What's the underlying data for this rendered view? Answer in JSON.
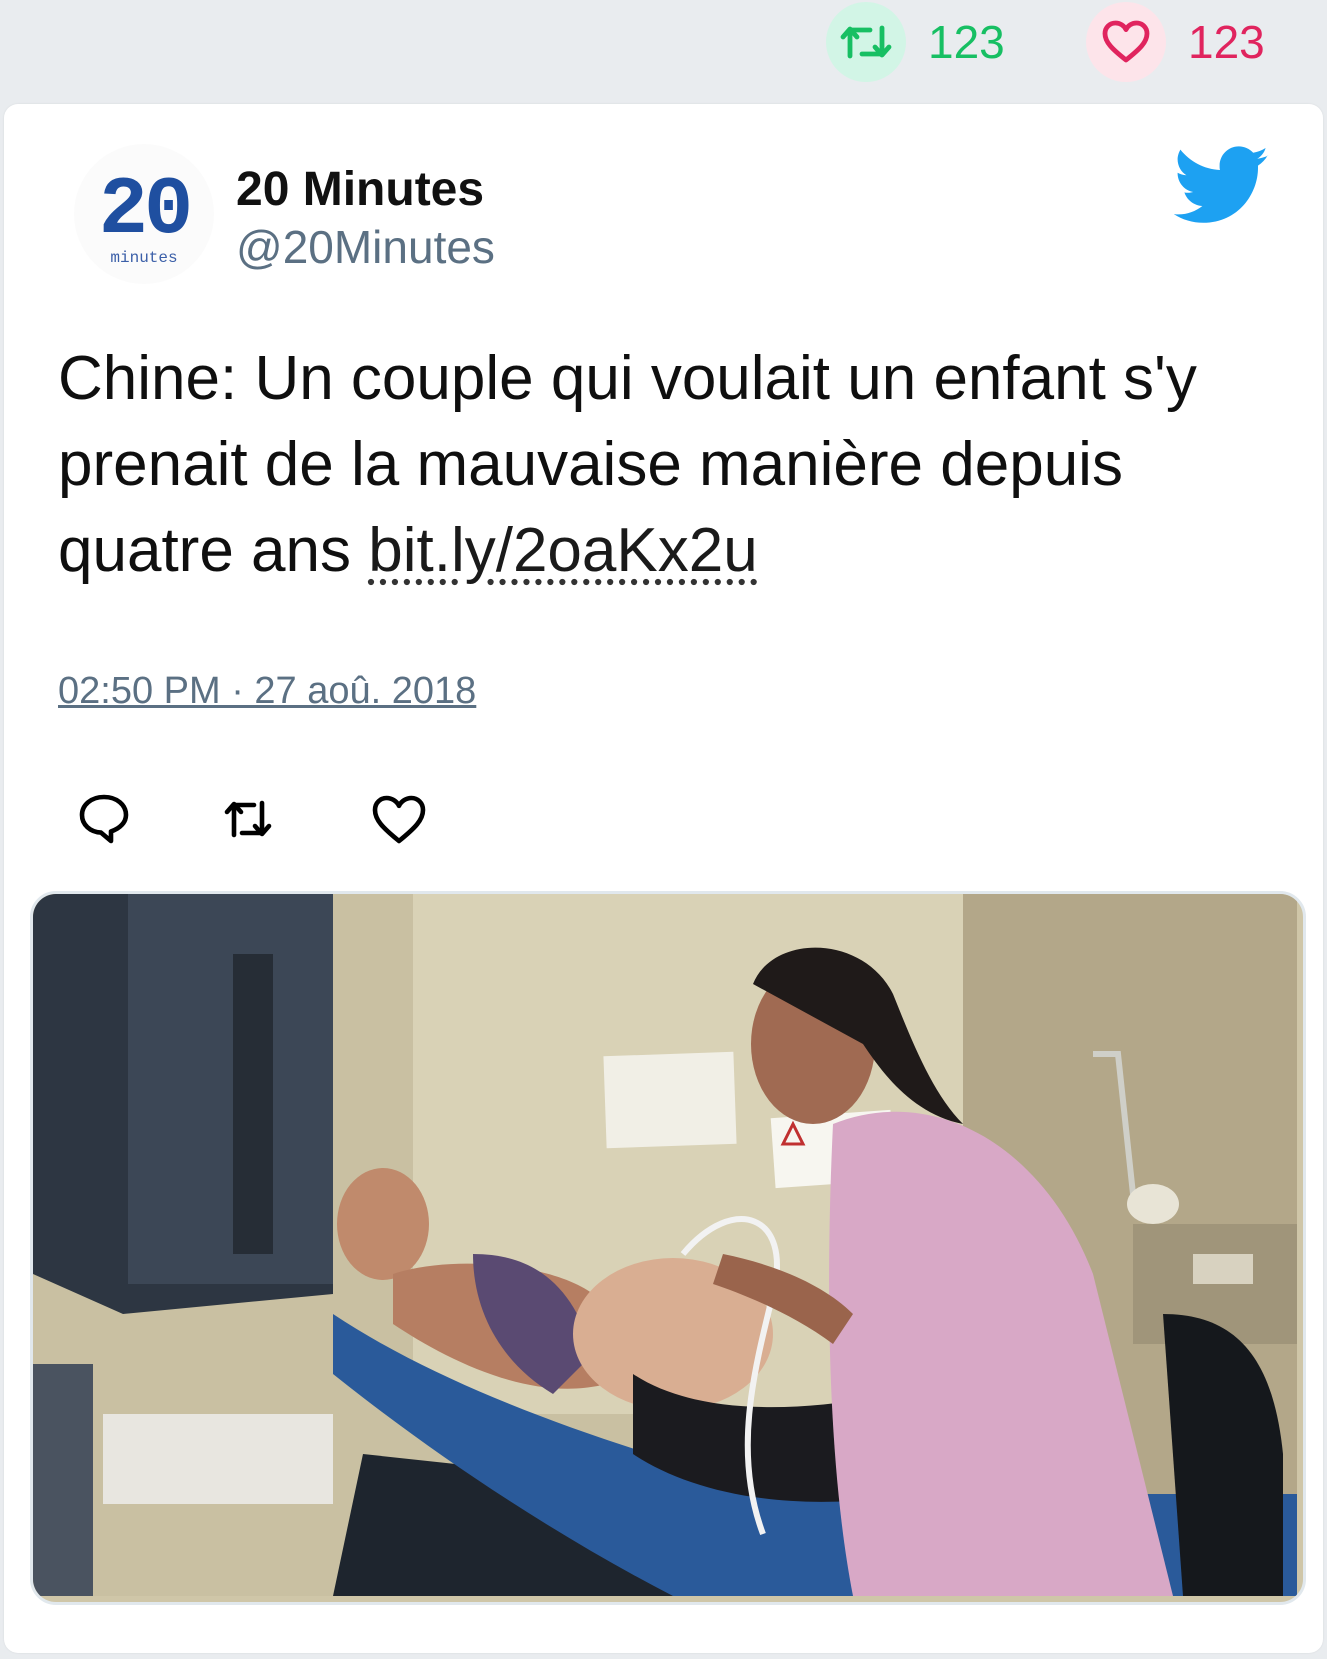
{
  "stats": {
    "retweets": "123",
    "likes": "123",
    "retweet_color": "#17bf63",
    "like_color": "#e0245e"
  },
  "author": {
    "name": "20 Minutes",
    "handle": "@20Minutes",
    "avatar_number": "20",
    "avatar_word": "minutes"
  },
  "tweet": {
    "text": "Chine: Un couple qui voulait un enfant s'y prenait de la mauvaise manière depuis quatre ans",
    "link": "bit.ly/2oaKx2u",
    "timestamp": "02:50 PM · 27 aoû. 2018"
  },
  "icons": {
    "brand": "twitter-bird-icon",
    "actions": [
      "reply-icon",
      "retweet-icon",
      "like-icon"
    ]
  },
  "media": {
    "subject": "ultrasound-exam-photo"
  }
}
